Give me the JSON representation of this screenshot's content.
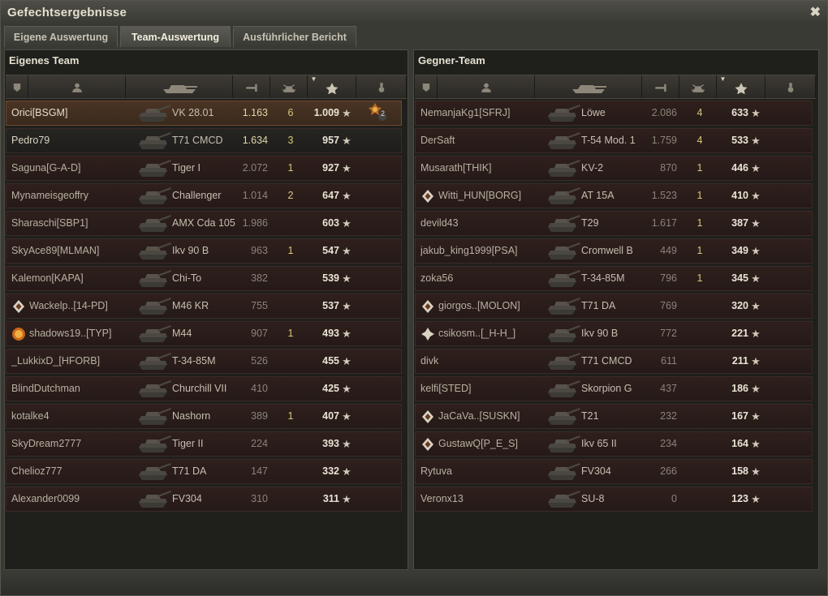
{
  "window": {
    "title": "Gefechtsergebnisse",
    "close_glyph": "✖"
  },
  "tabs": [
    {
      "label": "Eigene Auswertung",
      "active": false
    },
    {
      "label": "Team-Auswertung",
      "active": true
    },
    {
      "label": "Ausführlicher Bericht",
      "active": false
    }
  ],
  "columns": {
    "icons": [
      "squad-icon",
      "player-icon",
      "tank-icon",
      "damage-icon",
      "kills-icon",
      "xp-star-icon",
      "medal-icon"
    ],
    "sorted_column": "xp-star-icon"
  },
  "own_team": {
    "title": "Eigenes Team",
    "rows": [
      {
        "name": "Orici[BSGM]",
        "tank": "VK 28.01",
        "dmg": "1.163",
        "kills": "6",
        "score": "1.009",
        "style": "highlight",
        "medal": "2"
      },
      {
        "name": "Pedro79",
        "tank": "T71 CMCD",
        "dmg": "1.634",
        "kills": "3",
        "score": "957",
        "style": "friend"
      },
      {
        "name": "Saguna[G-A-D]",
        "tank": "Tiger I",
        "dmg": "2.072",
        "kills": "1",
        "score": "927"
      },
      {
        "name": "Mynameisgeoffry",
        "tank": "Challenger",
        "dmg": "1.014",
        "kills": "2",
        "score": "647"
      },
      {
        "name": "Sharaschi[SBP1]",
        "tank": "AMX Cda 105",
        "dmg": "1.986",
        "kills": "",
        "score": "603"
      },
      {
        "name": "SkyAce89[MLMAN]",
        "tank": "Ikv 90 B",
        "dmg": "963",
        "kills": "1",
        "score": "547"
      },
      {
        "name": "Kalemon[KAPA]",
        "tank": "Chi-To",
        "dmg": "382",
        "kills": "",
        "score": "539"
      },
      {
        "name": "Wackelp..[14-PD]",
        "tank": "M46 KR",
        "dmg": "755",
        "kills": "",
        "score": "537",
        "badge": "platoon"
      },
      {
        "name": "shadows19..[TYP]",
        "tank": "M44",
        "dmg": "907",
        "kills": "1",
        "score": "493",
        "badge": "orange"
      },
      {
        "name": "_LukkixD_[HFORB]",
        "tank": "T-34-85M",
        "dmg": "526",
        "kills": "",
        "score": "455"
      },
      {
        "name": "BlindDutchman",
        "tank": "Churchill VII",
        "dmg": "410",
        "kills": "",
        "score": "425"
      },
      {
        "name": "kotalke4",
        "tank": "Nashorn",
        "dmg": "389",
        "kills": "1",
        "score": "407"
      },
      {
        "name": "SkyDream2777",
        "tank": "Tiger II",
        "dmg": "224",
        "kills": "",
        "score": "393"
      },
      {
        "name": "Chelioz777",
        "tank": "T71 DA",
        "dmg": "147",
        "kills": "",
        "score": "332"
      },
      {
        "name": "Alexander0099",
        "tank": "FV304",
        "dmg": "310",
        "kills": "",
        "score": "311"
      }
    ]
  },
  "enemy_team": {
    "title": "Gegner-Team",
    "rows": [
      {
        "name": "NemanjaKg1[SFRJ]",
        "tank": "Löwe",
        "dmg": "2.086",
        "kills": "4",
        "score": "633"
      },
      {
        "name": "DerSaft",
        "tank": "T-54 Mod. 1",
        "dmg": "1.759",
        "kills": "4",
        "score": "533"
      },
      {
        "name": "Musarath[THIK]",
        "tank": "KV-2",
        "dmg": "870",
        "kills": "1",
        "score": "446"
      },
      {
        "name": "Witti_HUN[BORG]",
        "tank": "AT 15A",
        "dmg": "1.523",
        "kills": "1",
        "score": "410",
        "badge": "platoon"
      },
      {
        "name": "devild43",
        "tank": "T29",
        "dmg": "1.617",
        "kills": "1",
        "score": "387"
      },
      {
        "name": "jakub_king1999[PSA]",
        "tank": "Cromwell B",
        "dmg": "449",
        "kills": "1",
        "score": "349"
      },
      {
        "name": "zoka56",
        "tank": "T-34-85M",
        "dmg": "796",
        "kills": "1",
        "score": "345"
      },
      {
        "name": "giorgos..[MOLON]",
        "tank": "T71 DA",
        "dmg": "769",
        "kills": "",
        "score": "320",
        "badge": "platoon"
      },
      {
        "name": "csikosm..[_H-H_]",
        "tank": "Ikv 90 B",
        "dmg": "772",
        "kills": "",
        "score": "221",
        "badge": "cross"
      },
      {
        "name": "divk",
        "tank": "T71 CMCD",
        "dmg": "611",
        "kills": "",
        "score": "211"
      },
      {
        "name": "kelfi[STED]",
        "tank": "Skorpion G",
        "dmg": "437",
        "kills": "",
        "score": "186"
      },
      {
        "name": "JaCaVa..[SUSKN]",
        "tank": "T21",
        "dmg": "232",
        "kills": "",
        "score": "167",
        "badge": "platoon"
      },
      {
        "name": "GustawQ[P_E_S]",
        "tank": "Ikv 65 II",
        "dmg": "234",
        "kills": "",
        "score": "164",
        "badge": "platoon"
      },
      {
        "name": "Rytuva",
        "tank": "FV304",
        "dmg": "266",
        "kills": "",
        "score": "158"
      },
      {
        "name": "Veronx13",
        "tank": "SU-8",
        "dmg": "0",
        "kills": "",
        "score": "123"
      }
    ]
  },
  "colors": {
    "accent": "#d8c77a",
    "row_bg": "#2f1f1c",
    "highlight_bg": "#4a3424",
    "panel_bg": "#1f1f1c"
  }
}
